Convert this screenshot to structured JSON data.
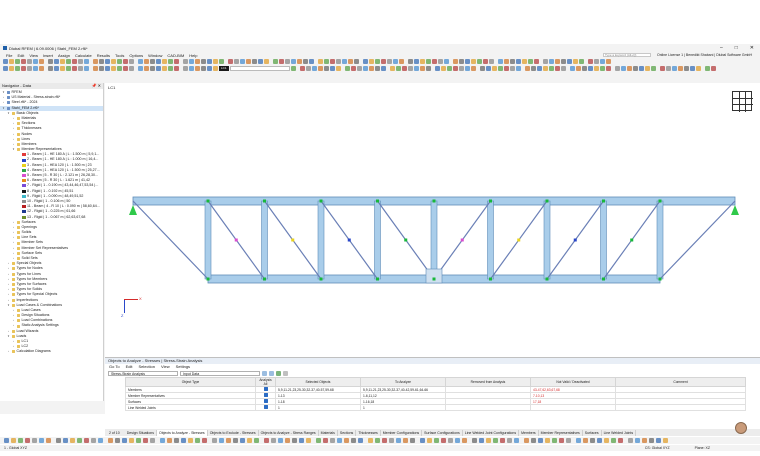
{
  "window": {
    "title": "Dlubal RFEM | 6.09.0006 | Stahl_FEM 2.rf6*",
    "controls": [
      "–",
      "□",
      "✕"
    ]
  },
  "menu": {
    "items": [
      "File",
      "Edit",
      "View",
      "Insert",
      "Assign",
      "Calculate",
      "Results",
      "Tools",
      "Options",
      "Window",
      "CAD-BIM",
      "Help"
    ],
    "search_placeholder": "Type a keyword (Alt+Q)",
    "license": "Online License 1 | Benedikt Shabani | Dlubal Software GmbH"
  },
  "toolbar": {
    "lc_code": "LC1",
    "lc_name": ""
  },
  "navigator": {
    "title": "Navigator - Data",
    "items": [
      {
        "label": "RFEM",
        "indent": 0,
        "kind": "root",
        "toggle": "▾"
      },
      {
        "label": "US Material - Stress-strain.rf6*",
        "indent": 0,
        "kind": "file",
        "toggle": "›"
      },
      {
        "label": "Steel.rf6* - 2024",
        "indent": 0,
        "kind": "file",
        "toggle": "›"
      },
      {
        "label": "Stahl_FEM 2.rf6*",
        "indent": 0,
        "kind": "file",
        "toggle": "▾",
        "selected": true
      },
      {
        "label": "Basic Objects",
        "indent": 1,
        "kind": "folder",
        "toggle": "▾"
      },
      {
        "label": "Materials",
        "indent": 2,
        "kind": "folder",
        "toggle": "›"
      },
      {
        "label": "Sections",
        "indent": 2,
        "kind": "folder",
        "toggle": "›"
      },
      {
        "label": "Thicknesses",
        "indent": 2,
        "kind": "folder",
        "toggle": "›"
      },
      {
        "label": "Nodes",
        "indent": 2,
        "kind": "folder",
        "toggle": "›"
      },
      {
        "label": "Lines",
        "indent": 2,
        "kind": "folder",
        "toggle": "›"
      },
      {
        "label": "Members",
        "indent": 2,
        "kind": "folder",
        "toggle": "›"
      },
      {
        "label": "Member Representatives",
        "indent": 2,
        "kind": "folder",
        "toggle": "▾"
      },
      {
        "label": "1 - Beam | 1 - HE 180 A | L : 1.500 m | 5,9,1...",
        "indent": 3,
        "kind": "swatch",
        "color": "#e23b3b"
      },
      {
        "label": "2 - Beam | 1 - HE 180 A | L : 1.000 m | 16,4...",
        "indent": 3,
        "kind": "swatch",
        "color": "#2a47c9"
      },
      {
        "label": "3 - Beam | 1 - HEA 120 | L : 1.500 m | 23",
        "indent": 3,
        "kind": "swatch",
        "color": "#e8d21c"
      },
      {
        "label": "4 - Beam | 1 - HEA 120 | L : 1.500 m | 25,27...",
        "indent": 3,
        "kind": "swatch",
        "color": "#2fa84a"
      },
      {
        "label": "5 - Beam | 5 - R 30 | L : 2.121 m | 26,28,30...",
        "indent": 3,
        "kind": "swatch",
        "color": "#d84fd0"
      },
      {
        "label": "6 - Beam | 5 - R 30 | L : 1.621 m | 41,42",
        "indent": 3,
        "kind": "swatch",
        "color": "#e8891c"
      },
      {
        "label": "7 - Rigid | 1 - 0.190 m | 43,44,46,47,53,54 |...",
        "indent": 3,
        "kind": "swatch",
        "color": "#7a4bd6"
      },
      {
        "label": "8 - Rigid | 1 - 0.192 m | 45,51",
        "indent": 3,
        "kind": "swatch",
        "color": "#1a1a1a"
      },
      {
        "label": "9 - Rigid | 1 - 0.090 m | 48,49,51,52",
        "indent": 3,
        "kind": "swatch",
        "color": "#3fb8c9"
      },
      {
        "label": "10 - Rigid | 1 - 0.106 m | 50",
        "indent": 3,
        "kind": "swatch",
        "color": "#8f8f8f"
      },
      {
        "label": "11 - Beam | 4 - R 10 | L : 0.090 m | 58,60,64...",
        "indent": 3,
        "kind": "swatch",
        "color": "#b82020"
      },
      {
        "label": "12 - Rigid | 1 - 0.225 m | 61,66",
        "indent": 3,
        "kind": "swatch",
        "color": "#1f3a8f"
      },
      {
        "label": "13 - Rigid | 1 - 0.067 m | 62,63,67,68",
        "indent": 3,
        "kind": "swatch",
        "color": "#6e8f2a"
      },
      {
        "label": "Surfaces",
        "indent": 2,
        "kind": "folder",
        "toggle": "›"
      },
      {
        "label": "Openings",
        "indent": 2,
        "kind": "folder",
        "toggle": "›"
      },
      {
        "label": "Solids",
        "indent": 2,
        "kind": "folder",
        "toggle": "›"
      },
      {
        "label": "Line Sets",
        "indent": 2,
        "kind": "folder",
        "toggle": "›"
      },
      {
        "label": "Member Sets",
        "indent": 2,
        "kind": "folder",
        "toggle": "›"
      },
      {
        "label": "Member Set Representatives",
        "indent": 2,
        "kind": "folder",
        "toggle": "›"
      },
      {
        "label": "Surface Sets",
        "indent": 2,
        "kind": "folder",
        "toggle": "›"
      },
      {
        "label": "Solid Sets",
        "indent": 2,
        "kind": "folder",
        "toggle": "›"
      },
      {
        "label": "Special Objects",
        "indent": 1,
        "kind": "folder",
        "toggle": "›"
      },
      {
        "label": "Types for Nodes",
        "indent": 1,
        "kind": "folder",
        "toggle": "›"
      },
      {
        "label": "Types for Lines",
        "indent": 1,
        "kind": "folder",
        "toggle": "›"
      },
      {
        "label": "Types for Members",
        "indent": 1,
        "kind": "folder",
        "toggle": "›"
      },
      {
        "label": "Types for Surfaces",
        "indent": 1,
        "kind": "folder",
        "toggle": "›"
      },
      {
        "label": "Types for Solids",
        "indent": 1,
        "kind": "folder",
        "toggle": "›"
      },
      {
        "label": "Types for Special Objects",
        "indent": 1,
        "kind": "folder",
        "toggle": "›"
      },
      {
        "label": "Imperfections",
        "indent": 1,
        "kind": "folder",
        "toggle": "›"
      },
      {
        "label": "Load Cases & Combinations",
        "indent": 1,
        "kind": "folder",
        "toggle": "▾"
      },
      {
        "label": "Load Cases",
        "indent": 2,
        "kind": "folder",
        "toggle": "›"
      },
      {
        "label": "Design Situations",
        "indent": 2,
        "kind": "folder",
        "toggle": "›"
      },
      {
        "label": "Load Combinations",
        "indent": 2,
        "kind": "folder",
        "toggle": "›"
      },
      {
        "label": "Static Analysis Settings",
        "indent": 2,
        "kind": "folder",
        "toggle": "›"
      },
      {
        "label": "Load Wizards",
        "indent": 1,
        "kind": "folder",
        "toggle": "›"
      },
      {
        "label": "Loads",
        "indent": 1,
        "kind": "folder",
        "toggle": "▾"
      },
      {
        "label": "LC1",
        "indent": 2,
        "kind": "folder",
        "toggle": "›"
      },
      {
        "label": "LC2",
        "indent": 2,
        "kind": "folder",
        "toggle": "›"
      },
      {
        "label": "Calculation Diagrams",
        "indent": 1,
        "kind": "folder",
        "toggle": "›"
      }
    ]
  },
  "viewport": {
    "label": "LC1",
    "axis_x": "X",
    "axis_z": "Z"
  },
  "panel": {
    "title": "Objects to Analyze - Stresses | Stress-Strain Analysis",
    "menu": [
      "Go To",
      "Edit",
      "Selection",
      "View",
      "Settings"
    ],
    "analysis_select": "Stress-Strain Analysis",
    "data_select": "Input Data",
    "columns": [
      "Object Type",
      "Analysis All",
      "Selected Objects",
      "To Analyze",
      "Removed from Analysis",
      "Not Valid / Deactivated",
      "Comment"
    ],
    "rows": [
      {
        "type": "Members",
        "selected": "5,9,11-21,23,25-30,32-37,40-57,59-68",
        "to_analyze": "5,9,11-21,23,25-30,32-37,40-42,59-61,64-66",
        "removed": "",
        "not_valid": "43-47,62,63,67,68",
        "comment": ""
      },
      {
        "type": "Member Representatives",
        "selected": "1-13",
        "to_analyze": "1-6,11,12",
        "removed": "",
        "not_valid": "7-10,13",
        "comment": ""
      },
      {
        "type": "Surfaces",
        "selected": "1-18",
        "to_analyze": "1-16,18",
        "removed": "",
        "not_valid": "17,18",
        "comment": ""
      },
      {
        "type": "Line Welded Joints",
        "selected": "1",
        "to_analyze": "1",
        "removed": "",
        "not_valid": "",
        "comment": ""
      }
    ],
    "pager": "2 of 10"
  },
  "tabs": [
    "Design Situations",
    "Objects to Analyze - Stresses",
    "Objects to Exclude - Stresses",
    "Objects to Analyze - Stress Ranges",
    "Materials",
    "Sections",
    "Thicknesses",
    "Member Configurations",
    "Surface Configurations",
    "Line Welded Joint Configurations",
    "Members",
    "Member Representatives",
    "Surfaces",
    "Line Welded Joints"
  ],
  "status": {
    "left": "1 - Global XYZ",
    "cs": "CS: Global XYZ",
    "plane": "Plane: XZ"
  },
  "colors": {
    "member_fill": "#a9cdea",
    "member_edge": "#5f8db8",
    "diagonal": "#6a7fb6",
    "support": "#2fc94a",
    "node": "#17b83a"
  }
}
